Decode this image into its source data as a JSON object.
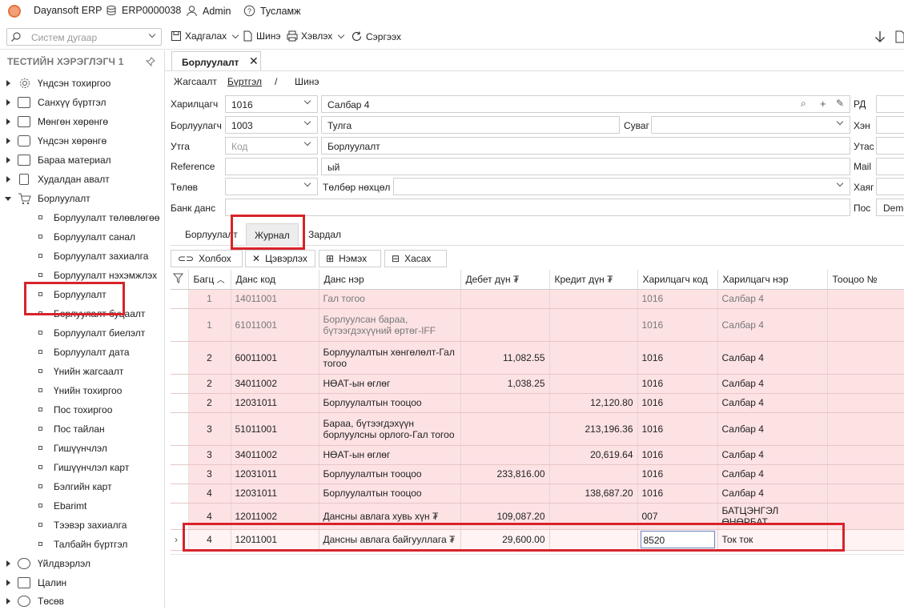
{
  "topbar": {
    "app_name": "Dayansoft ERP",
    "db_code": "ERP0000038",
    "user": "Admin",
    "help": "Тусламж"
  },
  "toolbar": {
    "search_placeholder": "Систем дугаар",
    "save": "Хадгалах",
    "new": "Шинэ",
    "print": "Хэвлэх",
    "refresh": "Сэргээх"
  },
  "sidebar": {
    "title": "ТЕСТИЙН ХЭРЭГЛЭГЧ 1",
    "groups": [
      {
        "label": "Үндсэн тохиргоо"
      },
      {
        "label": "Санхүү бүртгэл"
      },
      {
        "label": "Мөнгөн хөрөнгө"
      },
      {
        "label": "Үндсэн хөрөнгө"
      },
      {
        "label": "Бараа материал"
      },
      {
        "label": "Худалдан авалт"
      },
      {
        "label": "Борлуулалт"
      }
    ],
    "sales_items": [
      "Борлуулалт төлөвлөгөө",
      "Борлуулалт санал",
      "Борлуулалт захиалга",
      "Борлуулалт нэхэмжлэх",
      "Борлуулалт",
      "Борлуулалт буцаалт",
      "Борлуулалт биелэлт",
      "Борлуулалт дата",
      "Үнийн жагсаалт",
      "Үнийн тохиргоо",
      "Пос тохиргоо",
      "Пос тайлан",
      "Гишүүнчлэл",
      "Гишүүнчлэл карт",
      "Бэлгийн карт",
      "Ebarimt",
      "Тээвэр захиалга",
      "Талбайн бүртгэл"
    ],
    "bottom_groups": [
      "Үйлдвэрлэл",
      "Цалин",
      "Төсөв"
    ]
  },
  "main": {
    "tab_title": "Борлуулалт",
    "breadcrumb": {
      "list": "Жагсаалт",
      "register": "Бүртгэл",
      "sep": "/",
      "new": "Шинэ"
    },
    "form": {
      "customer_label": "Харилцагч",
      "customer_code": "1016",
      "customer_name": "Салбар 4",
      "seller_label": "Борлуулагч",
      "seller_code": "1003",
      "seller_name": "Тулга",
      "channel_label": "Суваг",
      "utga_label": "Утга",
      "utga_placeholder": "Код",
      "utga_value": "Борлуулалт",
      "reference_label": "Reference",
      "reference_value": "ый",
      "status_label": "Төлөв",
      "payment_label": "Төлбөр нөхцөл",
      "bank_label": "Банк данс",
      "rd_label": "РД",
      "khen_label": "Хэн",
      "phone_label": "Утас",
      "mail_label": "Mail",
      "address_label": "Хаяг",
      "pos_label": "Пос",
      "pos_value": "Demo"
    },
    "subtabs": [
      "Борлуулалт",
      "Журнал",
      "Зардал"
    ],
    "grid_buttons": {
      "link": "Холбох",
      "clear": "Цэвэрлэх",
      "add": "Нэмэх",
      "remove": "Хасах"
    },
    "grid": {
      "columns": [
        "Багц",
        "Данс код",
        "Данс нэр",
        "Дебет дүн ₮",
        "Кредит дүн ₮",
        "Харилцагч код",
        "Харилцагч нэр",
        "Тооцоо №"
      ],
      "rows": [
        {
          "bagts": "1",
          "code": "14011001",
          "name": "Гал тогоо",
          "debit": "",
          "credit": "",
          "ccode": "1016",
          "cname": "Салбар 4",
          "muted": true
        },
        {
          "bagts": "1",
          "code": "61011001",
          "name": "Борлуулсан бараа, бүтээгдэхүүний өртөг-IFF",
          "debit": "",
          "credit": "",
          "ccode": "1016",
          "cname": "Салбар 4",
          "muted": true
        },
        {
          "bagts": "2",
          "code": "60011001",
          "name": "Борлуулалтын хөнгөлөлт-Гал тогоо",
          "debit": "11,082.55",
          "credit": "",
          "ccode": "1016",
          "cname": "Салбар 4"
        },
        {
          "bagts": "2",
          "code": "34011002",
          "name": "НӨАТ-ын өглөг",
          "debit": "1,038.25",
          "credit": "",
          "ccode": "1016",
          "cname": "Салбар 4"
        },
        {
          "bagts": "2",
          "code": "12031011",
          "name": "Борлуулалтын тооцоо",
          "debit": "",
          "credit": "12,120.80",
          "ccode": "1016",
          "cname": "Салбар 4"
        },
        {
          "bagts": "3",
          "code": "51011001",
          "name": "Бараа, бүтээгдэхүүн борлуулсны орлого-Гал тогоо",
          "debit": "",
          "credit": "213,196.36",
          "ccode": "1016",
          "cname": "Салбар 4"
        },
        {
          "bagts": "3",
          "code": "34011002",
          "name": "НӨАТ-ын өглөг",
          "debit": "",
          "credit": "20,619.64",
          "ccode": "1016",
          "cname": "Салбар 4"
        },
        {
          "bagts": "3",
          "code": "12031011",
          "name": "Борлуулалтын тооцоо",
          "debit": "233,816.00",
          "credit": "",
          "ccode": "1016",
          "cname": "Салбар 4"
        },
        {
          "bagts": "4",
          "code": "12031011",
          "name": "Борлуулалтын тооцоо",
          "debit": "",
          "credit": "138,687.20",
          "ccode": "1016",
          "cname": "Салбар 4"
        },
        {
          "bagts": "4",
          "code": "12011002",
          "name": "Дансны авлага хувь хүн ₮",
          "debit": "109,087.20",
          "credit": "",
          "ccode": "007",
          "cname": "БАТЦЭНГЭЛ ӨНӨРБАТ"
        },
        {
          "bagts": "4",
          "code": "12011001",
          "name": "Дансны авлага байгууллага ₮",
          "debit": "29,600.00",
          "credit": "",
          "ccode": "8520",
          "cname": "Ток ток"
        }
      ]
    }
  },
  "colors": {
    "row_pink": "#fde2e4",
    "highlight_red": "#d8232a",
    "selected_cell_border": "#6a86c4"
  }
}
